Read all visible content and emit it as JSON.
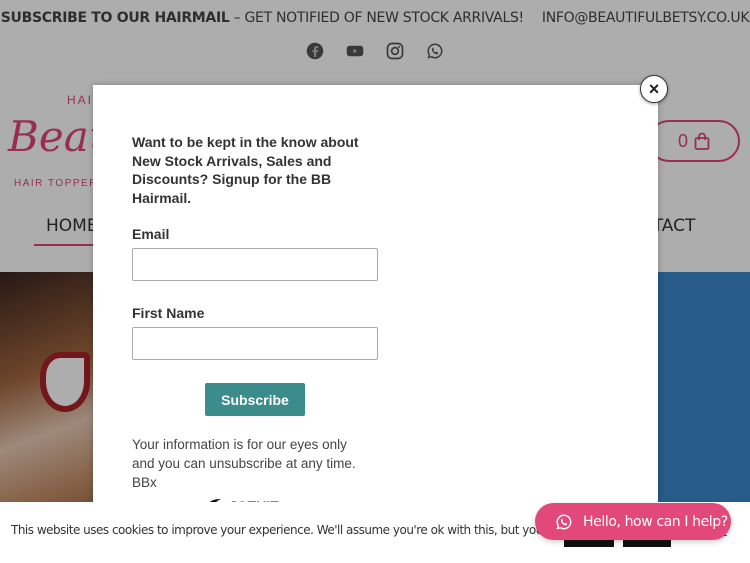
{
  "topbar": {
    "subscribe_bold": "SUBSCRIBE TO OUR HAIRMAIL",
    "subscribe_rest": " – GET NOTIFIED OF NEW STOCK ARRIVALS!",
    "email": "INFO@BEAUTIFULBETSY.CO.UK"
  },
  "socials": [
    "facebook-icon",
    "youtube-icon",
    "instagram-icon",
    "whatsapp-icon"
  ],
  "logo": {
    "top_text": "HAI",
    "script_text": "Beau",
    "bottom_text": "HAIR TOPPER"
  },
  "cart": {
    "count": "0"
  },
  "nav": {
    "home": "HOME",
    "contact": "NTACT"
  },
  "popup": {
    "intro": "Want to be kept in the know about New Stock Arrivals, Sales and Discounts? Signup for the BB Hairmail.",
    "email_label": "Email",
    "email_value": "",
    "first_name_label": "First Name",
    "first_name_value": "",
    "submit_label": "Subscribe",
    "disclaimer": "Your information is for our eyes only and you can unsubscribe at any time. BBx",
    "brand": "JOTUIT",
    "close_symbol": "×"
  },
  "cookie": {
    "text": "This website uses cookies to improve your experience. We'll assume you're ok with this, but you can opt-out if you w",
    "more": "re"
  },
  "chat": {
    "label": "Hello, how can I help?"
  },
  "colors": {
    "accent_pink": "#e0467a",
    "subscribe_teal": "#3b8c8a",
    "chat_pink": "#e3487b",
    "hero_blue": "#3a87c9"
  }
}
